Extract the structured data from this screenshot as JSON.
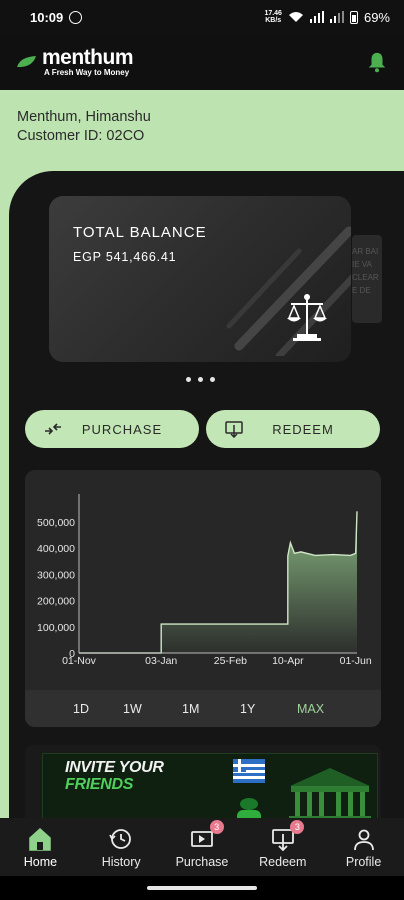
{
  "status_bar": {
    "time": "10:09",
    "speed_value": "17.46",
    "speed_unit": "KB/s",
    "battery": "69%"
  },
  "header": {
    "brand": "menthum",
    "tagline": "A Fresh Way to Money",
    "bell_icon": "bell-icon",
    "accent_color": "#4caf50"
  },
  "user": {
    "name": "Menthum, Himanshu",
    "customer_id": "Customer ID: 02CO"
  },
  "balance_card": {
    "title": "TOTAL BALANCE",
    "amount": "EGP 541,466.41",
    "icon": "scale-icon",
    "peek_lines": [
      "AR BAI",
      "IE VA",
      "CLEAR",
      "E DE"
    ]
  },
  "carousel": {
    "pages": 3
  },
  "actions": {
    "purchase_label": "PURCHASE",
    "redeem_label": "REDEEM"
  },
  "chart_data": {
    "type": "area",
    "x_ticks": [
      "01-Nov",
      "03-Jan",
      "25-Feb",
      "10-Apr",
      "01-Jun"
    ],
    "y_ticks": [
      "500,000",
      "400,000",
      "300,000",
      "200,000",
      "100,000",
      "0"
    ],
    "ylim": [
      0,
      560000
    ],
    "series": [
      {
        "values": [
          {
            "x": "01-Nov",
            "y": 0
          },
          {
            "x": "03-Jan",
            "y": 0
          },
          {
            "x": "03-Jan",
            "y": 110000
          },
          {
            "x": "10-Apr",
            "y": 110000
          },
          {
            "x": "10-Apr",
            "y": 370000
          },
          {
            "x": "12-Apr",
            "y": 420000
          },
          {
            "x": "15-Apr",
            "y": 380000
          },
          {
            "x": "20-Apr",
            "y": 385000
          },
          {
            "x": "01-May",
            "y": 372000
          },
          {
            "x": "15-May",
            "y": 375000
          },
          {
            "x": "28-May",
            "y": 372000
          },
          {
            "x": "01-Jun",
            "y": 380000
          },
          {
            "x": "02-Jun",
            "y": 540000
          }
        ]
      }
    ],
    "line_color": "#cfe6c6",
    "fill_color": "#8fbf87",
    "grid": false
  },
  "range_options": [
    "1D",
    "1W",
    "1M",
    "1Y",
    "MAX"
  ],
  "range_selected": "MAX",
  "promo": {
    "line1": "INVITE YOUR",
    "line2": "FRIENDS"
  },
  "nav": [
    {
      "label": "Home",
      "icon": "home-icon",
      "badge": ""
    },
    {
      "label": "History",
      "icon": "history-icon",
      "badge": ""
    },
    {
      "label": "Purchase",
      "icon": "purchase-icon",
      "badge": "3"
    },
    {
      "label": "Redeem",
      "icon": "redeem-icon",
      "badge": "3"
    },
    {
      "label": "Profile",
      "icon": "profile-icon",
      "badge": ""
    }
  ]
}
